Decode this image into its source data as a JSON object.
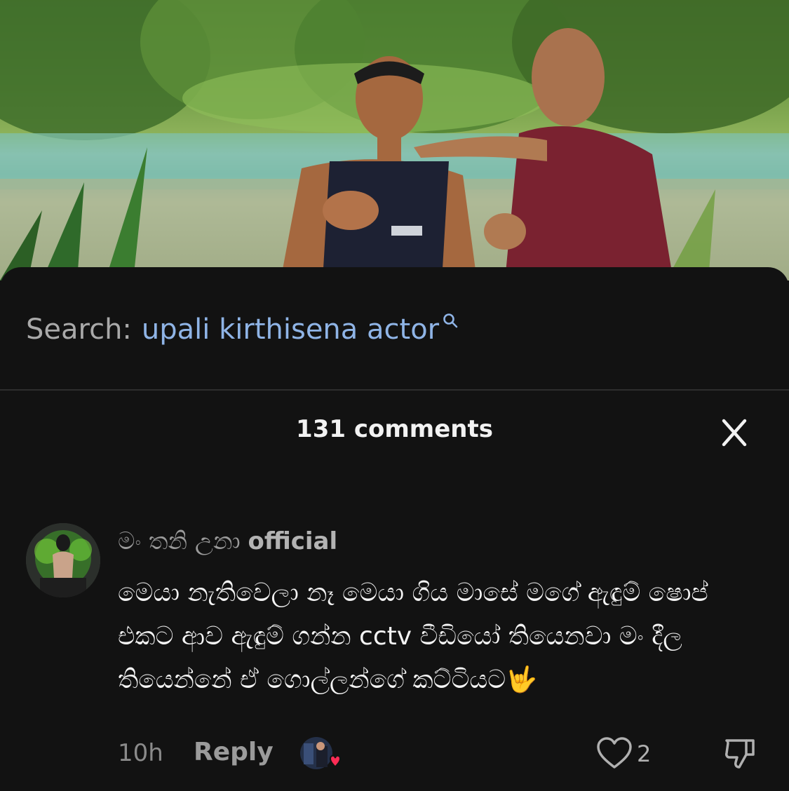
{
  "search": {
    "label": "Search:",
    "query": "upali kirthisena actor"
  },
  "comments": {
    "header": "131 comments",
    "items": [
      {
        "username_sinhala": "මං  තනි උනා",
        "username_suffix": "official",
        "lines": [
          "මෙයා නැතිවෙලා නෑ මෙයා ගිය මාසේ මගේ ඇඳුම් ෂොප්",
          "එකට ආව ඇඳුම් ගන්න cctv වීඩියෝ තියෙනවා මං දීල",
          "තියෙන්නේ ඒ ගොල්ලන්ගේ කට්ටියට🤟"
        ],
        "time": "10h",
        "reply_label": "Reply",
        "like_count": "2"
      }
    ]
  },
  "icons": {
    "search": "search-icon",
    "close": "close-icon",
    "like": "heart-icon",
    "dislike": "thumbs-down-icon"
  },
  "colors": {
    "background": "#121212",
    "query_link": "#8fb4e6",
    "creator_heart": "#fe2c55"
  }
}
